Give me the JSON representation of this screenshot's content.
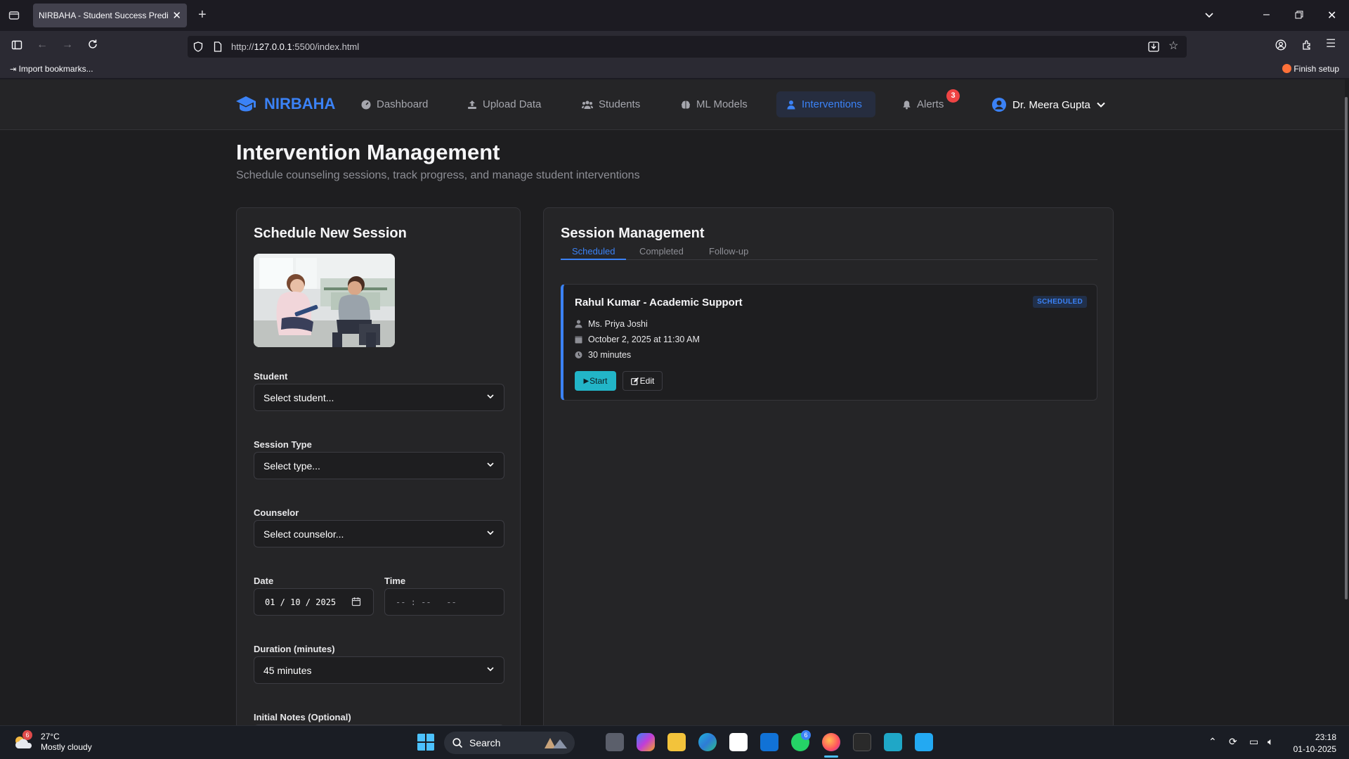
{
  "browser": {
    "tab_title": "NIRBAHA - Student Success Predict",
    "url_prefix": "http://",
    "url_host": "127.0.0.1",
    "url_rest": ":5500/index.html",
    "bookmark_import": "Import bookmarks...",
    "finish_setup": "Finish setup"
  },
  "app": {
    "brand": "NIRBAHA",
    "nav": [
      {
        "label": "Dashboard",
        "icon": "gauge-icon"
      },
      {
        "label": "Upload Data",
        "icon": "upload-icon"
      },
      {
        "label": "Students",
        "icon": "users-icon"
      },
      {
        "label": "ML Models",
        "icon": "brain-icon"
      },
      {
        "label": "Interventions",
        "icon": "user-icon",
        "active": true
      },
      {
        "label": "Alerts",
        "icon": "bell-icon",
        "badge": "3"
      }
    ],
    "user_name": "Dr. Meera Gupta",
    "accent": "#3b82f6"
  },
  "page": {
    "title": "Intervention Management",
    "subtitle": "Schedule counseling sessions, track progress, and manage student interventions"
  },
  "schedule": {
    "title": "Schedule New Session",
    "student_label": "Student",
    "student_value": "Select student...",
    "type_label": "Session Type",
    "type_value": "Select type...",
    "counselor_label": "Counselor",
    "counselor_value": "Select counselor...",
    "date_label": "Date",
    "date_value": "01 / 10 / 2025",
    "time_label": "Time",
    "time_value": "-- : --   --",
    "duration_label": "Duration (minutes)",
    "duration_value": "45 minutes",
    "notes_label": "Initial Notes (Optional)"
  },
  "sessions": {
    "title": "Session Management",
    "tabs": [
      "Scheduled",
      "Completed",
      "Follow-up"
    ],
    "items": [
      {
        "title": "Rahul Kumar - Academic Support",
        "status": "SCHEDULED",
        "counselor": "Ms. Priya Joshi",
        "datetime": "October 2, 2025 at 11:30 AM",
        "duration": "30 minutes",
        "start_label": "Start",
        "edit_label": "Edit"
      }
    ]
  },
  "taskbar": {
    "weather_badge": "6",
    "temperature": "27°C",
    "weather": "Mostly cloudy",
    "search": "Search",
    "whatsapp_badge": "6",
    "time": "23:18",
    "date": "01-10-2025"
  }
}
